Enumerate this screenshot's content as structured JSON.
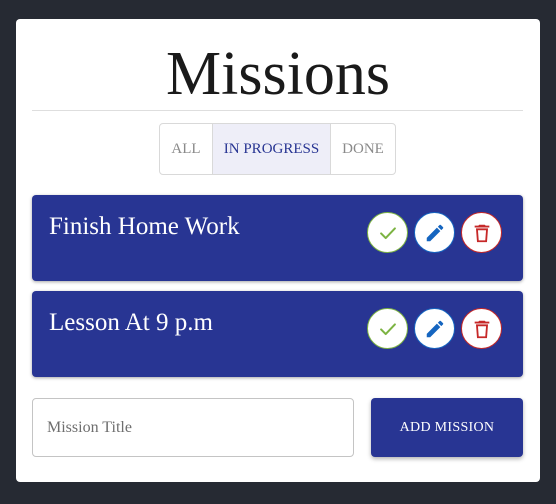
{
  "title": "Missions",
  "filters": {
    "all": "ALL",
    "in_progress": "IN PROGRESS",
    "done": "DONE",
    "selected": "IN PROGRESS"
  },
  "missions": [
    {
      "title": "Finish Home Work"
    },
    {
      "title": "Lesson At 9 p.m"
    }
  ],
  "actions": {
    "complete_icon": "check-icon",
    "edit_icon": "pencil-icon",
    "delete_icon": "trash-icon"
  },
  "form": {
    "input_value": "",
    "input_placeholder": "Mission Title",
    "add_label": "ADD MISSION"
  },
  "colors": {
    "background": "#262a33",
    "primary": "#283593",
    "complete": "#7cb342",
    "edit": "#1565c0",
    "delete": "#c62828"
  }
}
